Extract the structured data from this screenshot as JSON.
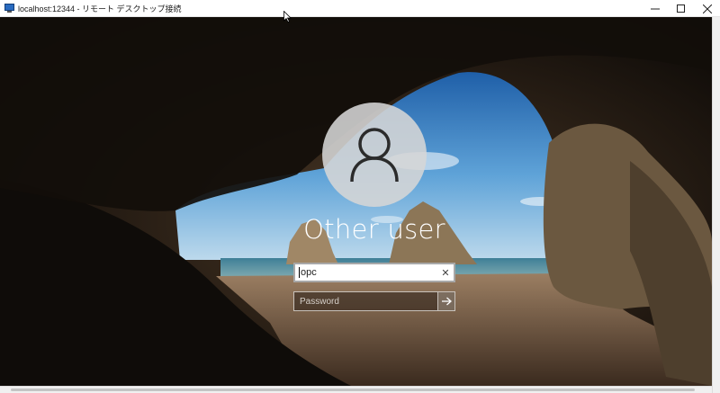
{
  "window": {
    "title": "localhost:12344 - リモート デスクトップ接続",
    "buttons": {
      "minimize": "minimize-icon",
      "maximize": "maximize-icon",
      "close": "close-icon"
    }
  },
  "login": {
    "user_display_name": "Other user",
    "username_value": "opc",
    "clear_glyph": "✕",
    "password_placeholder": "Password",
    "submit_icon": "arrow-right-icon"
  },
  "colors": {
    "field_border": "#a8a8a8",
    "avatar_bg": "#d6d6d6",
    "text_white": "#ffffff"
  }
}
